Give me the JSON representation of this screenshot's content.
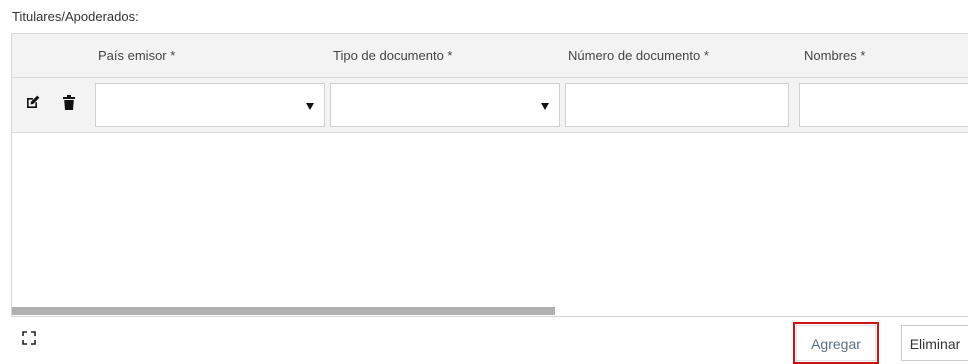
{
  "section": {
    "label": "Titulares/Apoderados:"
  },
  "grid": {
    "columns": [
      {
        "label": "País emisor *"
      },
      {
        "label": "Tipo de documento *"
      },
      {
        "label": "Número de documento *"
      },
      {
        "label": "Nombres *"
      }
    ],
    "row": {
      "pais_emisor": "",
      "tipo_documento": "",
      "numero_documento": "",
      "nombres": ""
    },
    "icons": {
      "edit": "edit-icon",
      "delete": "trash-icon",
      "dropdown": "caret-down-icon",
      "expand": "fullscreen-icon"
    }
  },
  "footer": {
    "add_label": "Agregar",
    "delete_label": "Eliminar",
    "highlight_color": "#cc1111"
  }
}
